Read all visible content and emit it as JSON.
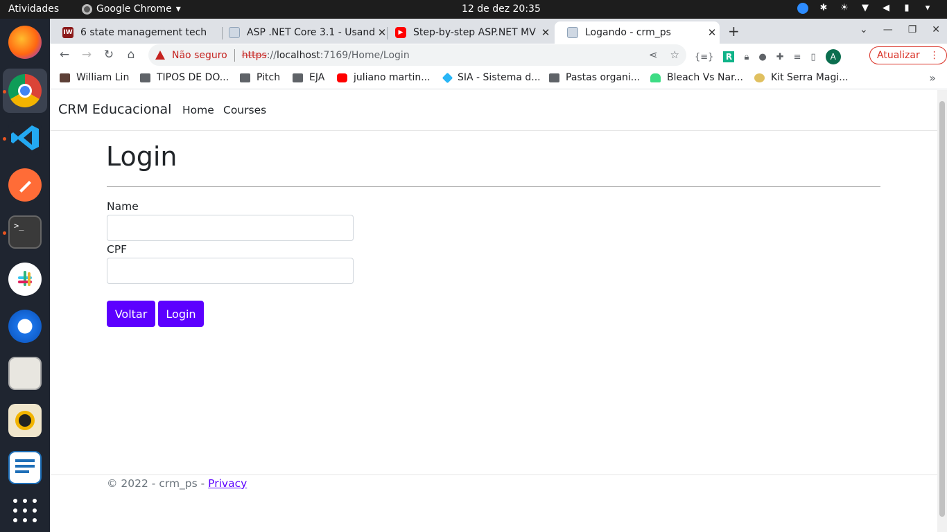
{
  "topbar": {
    "activities": "Atividades",
    "app_name": "Google Chrome",
    "clock": "12 de dez  20:35"
  },
  "tabs": [
    {
      "title": "6 state management tech",
      "favicon": "iw-icon",
      "active": false
    },
    {
      "title": "ASP .NET Core 3.1 - Usand",
      "favicon": "page-icon",
      "active": false
    },
    {
      "title": "Step-by-step ASP.NET MV",
      "favicon": "youtube-icon",
      "active": false
    },
    {
      "title": "Logando - crm_ps",
      "favicon": "page-icon",
      "active": true
    }
  ],
  "omnibox": {
    "security_label": "Não seguro",
    "scheme": "https",
    "separator": "://",
    "host": "localhost",
    "path": ":7169/Home/Login"
  },
  "toolbar": {
    "update_label": "Atualizar",
    "avatar_letter": "A"
  },
  "bookmarks": [
    {
      "label": "William Lin",
      "icon": "wl"
    },
    {
      "label": "TIPOS DE DO...",
      "icon": "folder"
    },
    {
      "label": "Pitch",
      "icon": "folder"
    },
    {
      "label": "EJA",
      "icon": "folder"
    },
    {
      "label": "juliano martin...",
      "icon": "yt"
    },
    {
      "label": "SIA - Sistema d...",
      "icon": "dia"
    },
    {
      "label": "Pastas organi...",
      "icon": "folder"
    },
    {
      "label": "Bleach Vs Nar...",
      "icon": "android"
    },
    {
      "label": "Kit Serra Magi...",
      "icon": "kit"
    }
  ],
  "site": {
    "brand": "CRM Educacional",
    "nav": [
      "Home",
      "Courses"
    ]
  },
  "login": {
    "heading": "Login",
    "name_label": "Name",
    "name_value": "",
    "cpf_label": "CPF",
    "cpf_value": "",
    "back_label": "Voltar",
    "login_label": "Login"
  },
  "footer": {
    "text": "© 2022 - crm_ps - ",
    "privacy": "Privacy"
  },
  "colors": {
    "accent": "#5c00ff",
    "warning": "#c5221f"
  }
}
